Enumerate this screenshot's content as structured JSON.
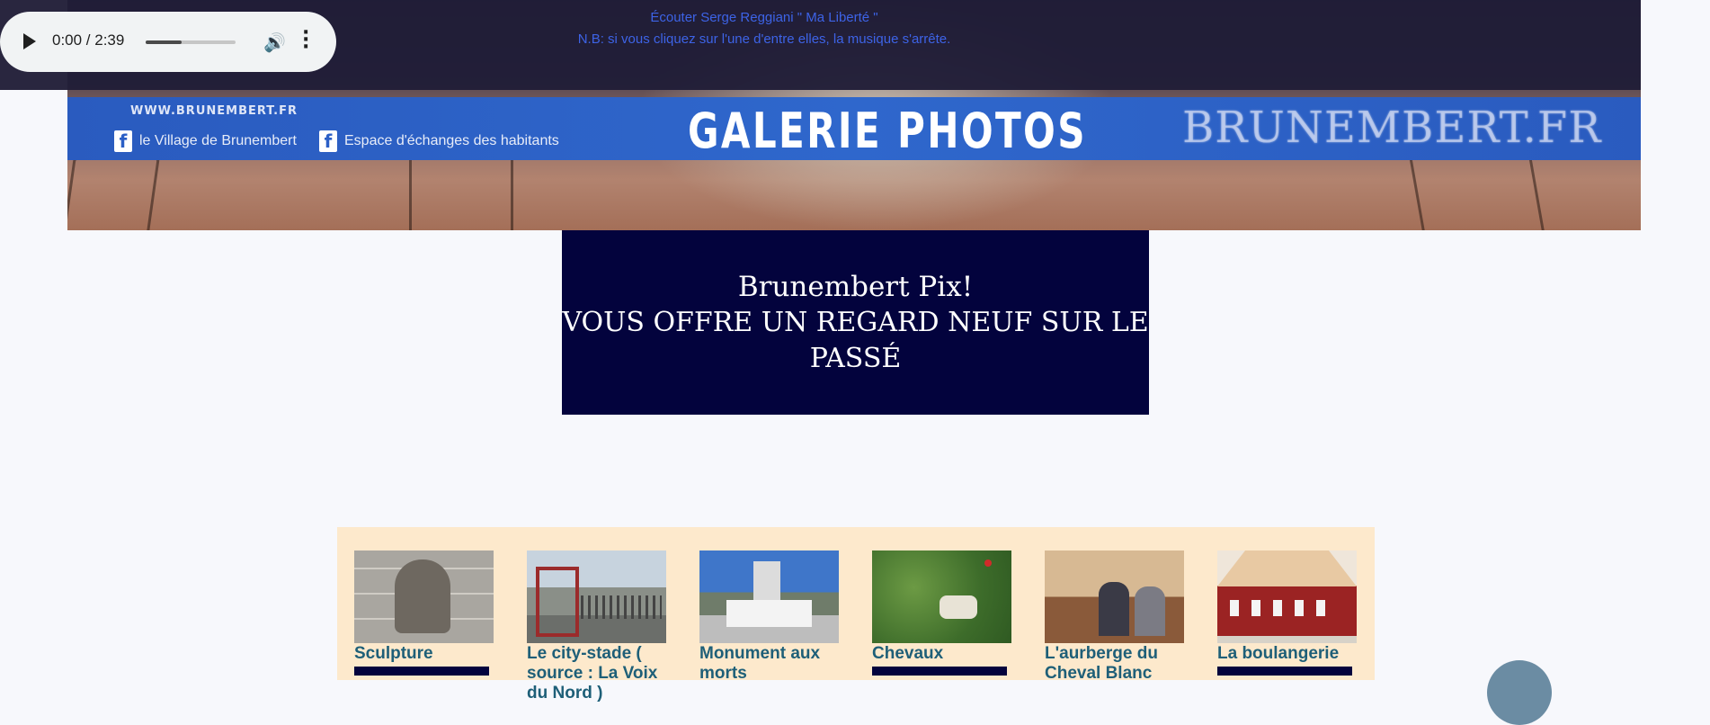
{
  "audio": {
    "time": "0:00 / 2:39",
    "progress_fraction": 0.4
  },
  "topbar": {
    "listen_text": "Écouter Serge Reggiani \" Ma Liberté \"",
    "note_text": "N.B: si vous cliquez sur l'une d'entre elles, la musique s'arrête."
  },
  "banner": {
    "site_url": "WWW.BRUNEMBERT.FR",
    "fb_link_1": "le Village de Brunembert",
    "fb_link_2": "Espace d'échanges des habitants",
    "title": "GALERIE PHOTOS",
    "watermark": "BRUNEMBERT.FR",
    "fb_glyph": "f"
  },
  "hero": {
    "line1": "Brunembert Pix!",
    "line2": "VOUS OFFRE UN REGARD NEUF SUR LE PASSÉ"
  },
  "gallery": {
    "items": [
      {
        "caption": "Sculpture"
      },
      {
        "caption": "Le city-stade ( source : La Voix du Nord )"
      },
      {
        "caption": "Monument aux morts"
      },
      {
        "caption": "Chevaux"
      },
      {
        "caption": "L'aurberge du Cheval Blanc"
      },
      {
        "caption": "La boulangerie"
      }
    ]
  },
  "colors": {
    "accent_blue": "#2f67cc",
    "navy": "#03033d",
    "caption": "#1e5f78",
    "gallery_bg": "#fde9cc"
  }
}
